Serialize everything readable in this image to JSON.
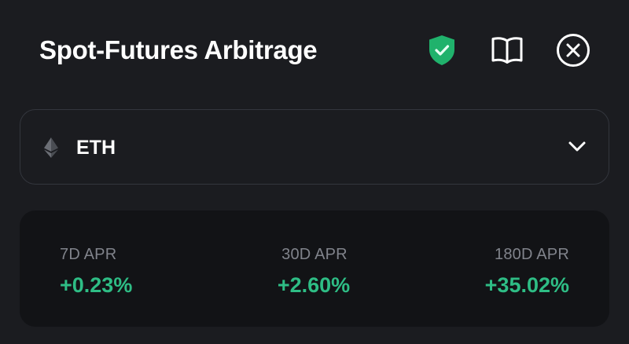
{
  "header": {
    "title": "Spot-Futures Arbitrage",
    "icons": [
      "shield-check-icon",
      "book-icon",
      "close-icon"
    ]
  },
  "selector": {
    "coin": "ETH",
    "coin_icon": "ethereum-icon",
    "dropdown_icon": "chevron-down-icon"
  },
  "stats": {
    "items": [
      {
        "label": "7D APR",
        "value": "+0.23%"
      },
      {
        "label": "30D APR",
        "value": "+2.60%"
      },
      {
        "label": "180D APR",
        "value": "+35.02%"
      }
    ]
  },
  "colors": {
    "background": "#1b1c20",
    "card": "#121316",
    "positive": "#2ebd85",
    "muted_text": "#80838b",
    "shield": "#20b26c"
  }
}
